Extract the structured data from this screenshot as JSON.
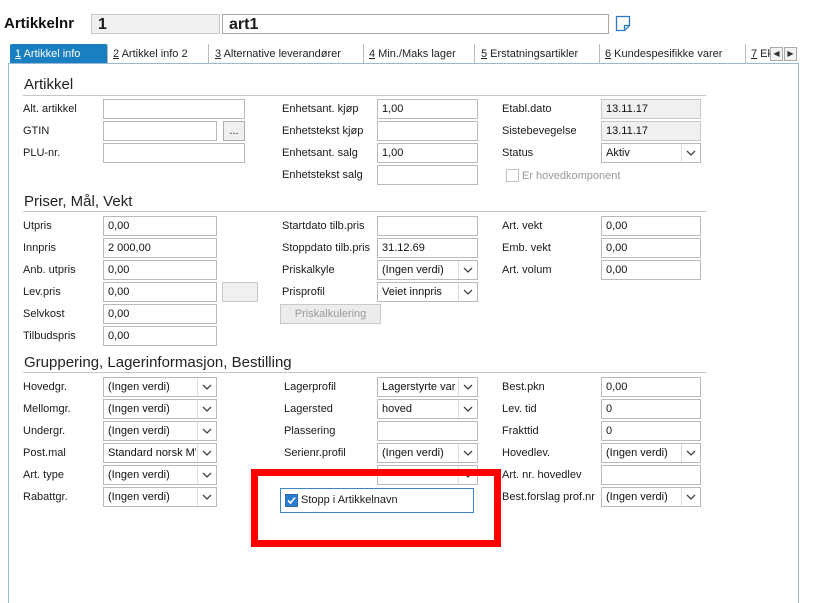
{
  "header": {
    "label": "Artikkelnr",
    "number": "1",
    "name": "art1"
  },
  "tabs": [
    {
      "key": "1",
      "rest": " Artikkel info"
    },
    {
      "key": "2",
      "rest": " Artikkel info 2"
    },
    {
      "key": "3",
      "rest": " Alternative leverandører"
    },
    {
      "key": "4",
      "rest": " Min./Maks lager"
    },
    {
      "key": "5",
      "rest": " Erstatningsartikler"
    },
    {
      "key": "6",
      "rest": " Kundespesifikke varer"
    },
    {
      "key": "7",
      "rest": " Ek"
    }
  ],
  "sections": {
    "artikkel": "Artikkel",
    "priser": "Priser, Mål, Vekt",
    "gruppering": "Gruppering, Lagerinformasjon, Bestilling"
  },
  "artikkel": {
    "alt_artikkel": {
      "label": "Alt. artikkel",
      "value": ""
    },
    "gtin": {
      "label": "GTIN",
      "value": "",
      "button": "..."
    },
    "plu": {
      "label": "PLU-nr.",
      "value": ""
    },
    "enhetsant_kjop": {
      "label": "Enhetsant. kjøp",
      "value": "1,00"
    },
    "enhetstekst_kjop": {
      "label": "Enhetstekst kjøp",
      "value": ""
    },
    "enhetsant_salg": {
      "label": "Enhetsant. salg",
      "value": "1,00"
    },
    "enhetstekst_salg": {
      "label": "Enhetstekst salg",
      "value": ""
    },
    "etabl_dato": {
      "label": "Etabl.dato",
      "value": "13.11.17"
    },
    "sistebevegelse": {
      "label": "Sistebevegelse",
      "value": "13.11.17"
    },
    "status": {
      "label": "Status",
      "value": "Aktiv"
    },
    "hovedkomponent": {
      "label": "Er hovedkomponent",
      "checked": false
    }
  },
  "priser": {
    "utpris": {
      "label": "Utpris",
      "value": "0,00"
    },
    "innpris": {
      "label": "Innpris",
      "value": "2 000,00"
    },
    "anb_utpris": {
      "label": "Anb. utpris",
      "value": "0,00"
    },
    "lev_pris": {
      "label": "Lev.pris",
      "value": "0,00"
    },
    "selvkost": {
      "label": "Selvkost",
      "value": "0,00"
    },
    "tilbudspris": {
      "label": "Tilbudspris",
      "value": "0,00"
    },
    "startdato": {
      "label": "Startdato tilb.pris",
      "value": ""
    },
    "stoppdato": {
      "label": "Stoppdato tilb.pris",
      "value": "31.12.69"
    },
    "priskalkyle": {
      "label": "Priskalkyle",
      "value": "(Ingen verdi)"
    },
    "prisprofil": {
      "label": "Prisprofil",
      "value": "Veiet innpris"
    },
    "priskalkulering_button": "Priskalkulering",
    "art_vekt": {
      "label": "Art. vekt",
      "value": "0,00"
    },
    "emb_vekt": {
      "label": "Emb. vekt",
      "value": "0,00"
    },
    "art_volum": {
      "label": "Art. volum",
      "value": "0,00"
    }
  },
  "gruppering": {
    "hovedgr": {
      "label": "Hovedgr.",
      "value": "(Ingen verdi)"
    },
    "mellomgr": {
      "label": "Mellomgr.",
      "value": "(Ingen verdi)"
    },
    "undergr": {
      "label": "Undergr.",
      "value": "(Ingen verdi)"
    },
    "post_mal": {
      "label": "Post.mal",
      "value": "Standard norsk MV"
    },
    "art_type": {
      "label": "Art. type",
      "value": "(Ingen verdi)"
    },
    "rabattgr": {
      "label": "Rabattgr.",
      "value": "(Ingen verdi)"
    },
    "lagerprofil": {
      "label": "Lagerprofil",
      "value": "Lagerstyrte var"
    },
    "lagersted": {
      "label": "Lagersted",
      "value": "hoved"
    },
    "plassering": {
      "label": "Plassering",
      "value": ""
    },
    "serienr_profil": {
      "label": "Serienr.profil",
      "value": "(Ingen verdi)"
    },
    "stopp_artikkelnavn": {
      "label": "Stopp i Artikkelnavn",
      "checked": true
    },
    "best_pkn": {
      "label": "Best.pkn",
      "value": "0,00"
    },
    "lev_tid": {
      "label": "Lev. tid",
      "value": "0"
    },
    "frakttid": {
      "label": "Frakttid",
      "value": "0"
    },
    "hovedlev": {
      "label": "Hovedlev.",
      "value": "(Ingen verdi)"
    },
    "art_nr_hovedlev": {
      "label": "Art. nr. hovedlev",
      "value": ""
    },
    "best_forslag": {
      "label": "Best.forslag prof.nr",
      "value": "(Ingen verdi)"
    }
  },
  "colors": {
    "active_tab": "#1a7fc1",
    "highlight": "#ff0000"
  }
}
